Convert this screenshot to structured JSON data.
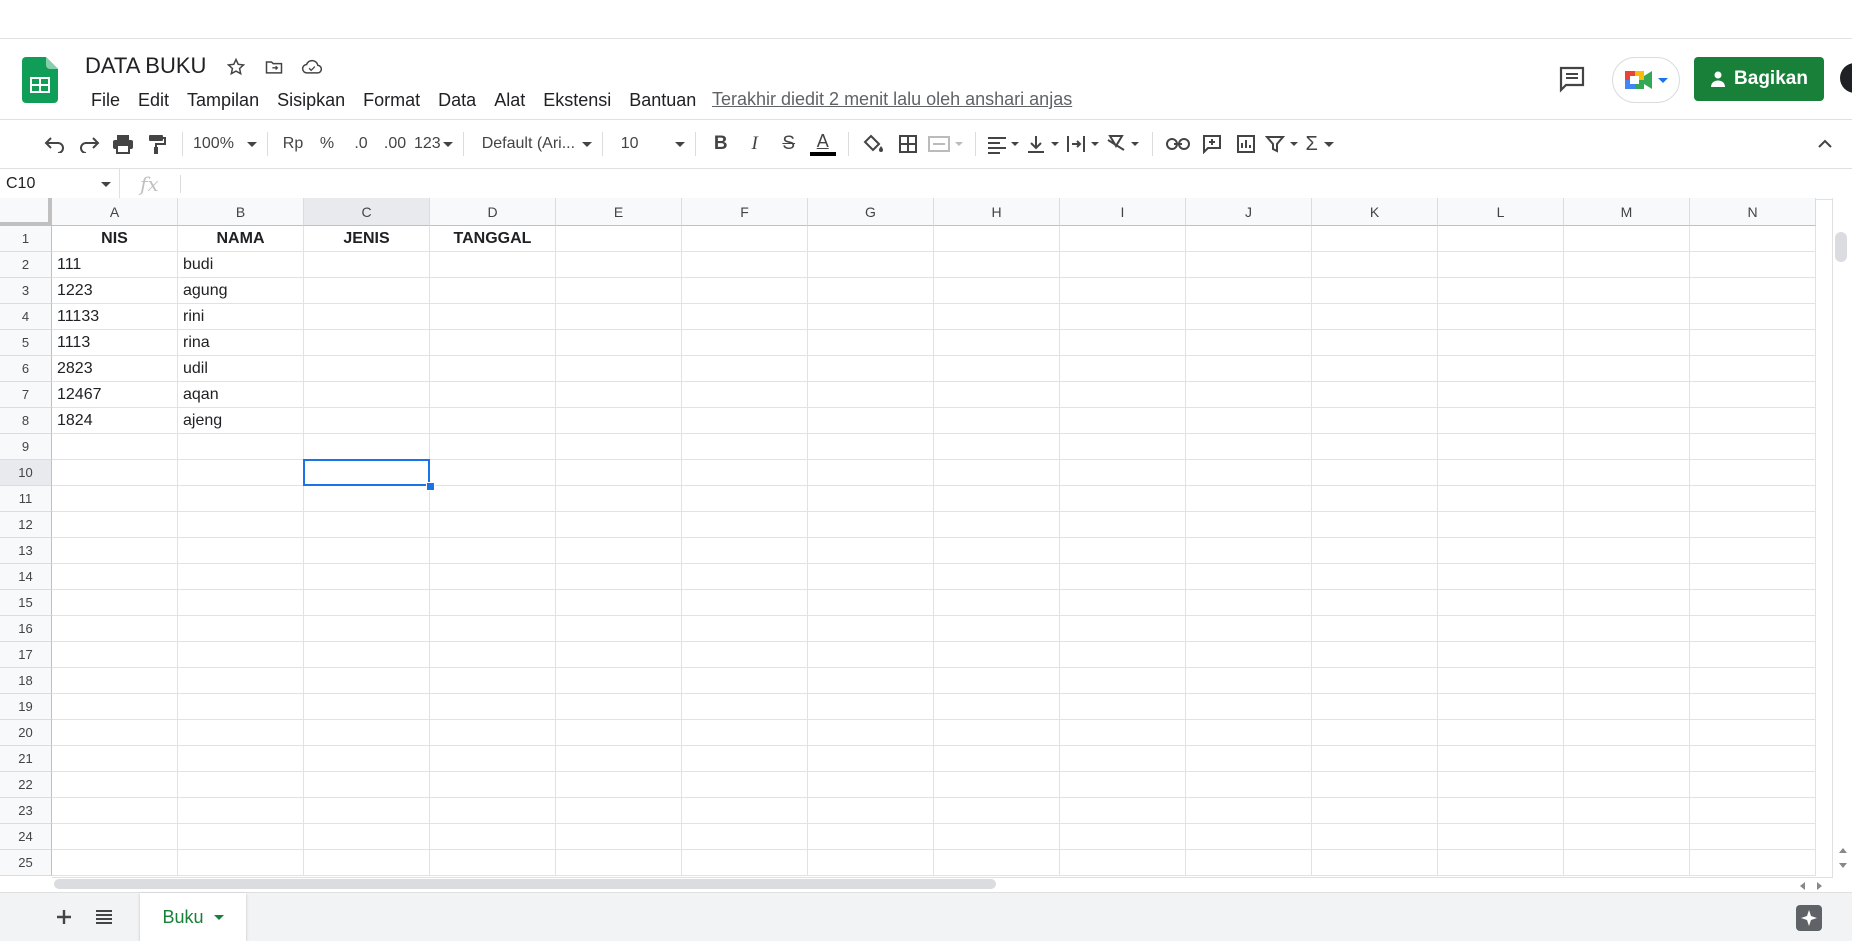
{
  "header": {
    "title": "DATA BUKU",
    "menu": [
      "File",
      "Edit",
      "Tampilan",
      "Sisipkan",
      "Format",
      "Data",
      "Alat",
      "Ekstensi",
      "Bantuan"
    ],
    "last_edit": "Terakhir diedit 2 menit lalu oleh anshari anjas",
    "share_label": "Bagikan"
  },
  "toolbar": {
    "zoom": "100%",
    "currency": "Rp",
    "percent": "%",
    "decrease_decimal": ".0",
    "increase_decimal": ".00",
    "more_formats": "123",
    "font": "Default (Ari...",
    "font_size": "10",
    "bold": "B",
    "italic": "I",
    "strike": "S",
    "text_color": "A",
    "sum": "Σ"
  },
  "formula_bar": {
    "name_box": "C10",
    "fx": "fx",
    "value": ""
  },
  "columns": [
    "A",
    "B",
    "C",
    "D",
    "E",
    "F",
    "G",
    "H",
    "I",
    "J",
    "K",
    "L",
    "M",
    "N"
  ],
  "rows": [
    "1",
    "2",
    "3",
    "4",
    "5",
    "6",
    "7",
    "8",
    "9",
    "10",
    "11",
    "12",
    "13",
    "14",
    "15",
    "16",
    "17",
    "18",
    "19",
    "20",
    "21",
    "22",
    "23",
    "24",
    "25"
  ],
  "cells": {
    "r1": [
      "NIS",
      "NAMA",
      "JENIS",
      "TANGGAL"
    ],
    "r2": [
      "111",
      "budi"
    ],
    "r3": [
      "1223",
      "agung"
    ],
    "r4": [
      "11133",
      "rini"
    ],
    "r5": [
      "1113",
      "rina"
    ],
    "r6": [
      "2823",
      "udil"
    ],
    "r7": [
      "12467",
      "aqan"
    ],
    "r8": [
      "1824",
      "ajeng"
    ]
  },
  "selected_cell": {
    "column": "C",
    "row": "10"
  },
  "sheets": {
    "active": "Buku"
  },
  "colors": {
    "brand_green": "#188038",
    "selection_blue": "#1a73e8"
  }
}
